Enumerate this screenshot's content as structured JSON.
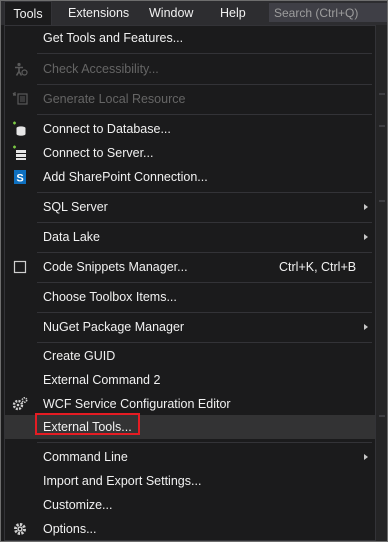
{
  "menubar": {
    "tools": "Tools",
    "extensions": "Extensions",
    "window": "Window",
    "help": "Help",
    "search_placeholder": "Search (Ctrl+Q)"
  },
  "tools_menu": {
    "get_tools": "Get Tools and Features...",
    "check_accessibility": "Check Accessibility...",
    "generate_local_resource": "Generate Local Resource",
    "connect_database": "Connect to Database...",
    "connect_server": "Connect to Server...",
    "add_sharepoint": "Add SharePoint Connection...",
    "sql_server": "SQL Server",
    "data_lake": "Data Lake",
    "code_snippets": "Code Snippets Manager...",
    "code_snippets_shortcut": "Ctrl+K, Ctrl+B",
    "choose_toolbox": "Choose Toolbox Items...",
    "nuget": "NuGet Package Manager",
    "create_guid": "Create GUID",
    "external_command_2": "External Command 2",
    "wcf_editor": "WCF Service Configuration Editor",
    "external_tools": "External Tools...",
    "command_line": "Command Line",
    "import_export": "Import and Export Settings...",
    "customize": "Customize...",
    "options": "Options..."
  },
  "icons": {
    "sharepoint_letter": "S"
  },
  "colors": {
    "menu_bg": "#1b1b1c",
    "menubar_bg": "#2d2d30",
    "text": "#f1f1f1",
    "disabled_text": "#656565",
    "highlight_border": "#e51c23",
    "sharepoint_blue": "#0e70c0"
  }
}
